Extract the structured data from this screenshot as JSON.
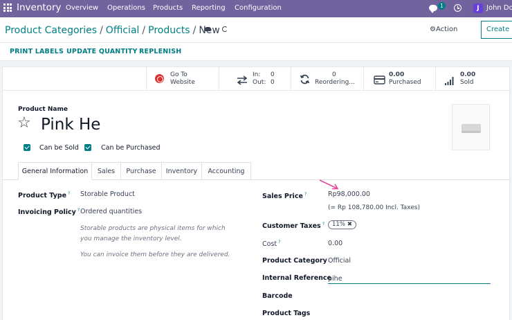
{
  "navbar": {
    "app_name": "Inventory",
    "menu": [
      "Overview",
      "Operations",
      "Products",
      "Reporting",
      "Configuration"
    ],
    "chat_badge": "1",
    "avatar_letter": "J",
    "user_name": "John Doe"
  },
  "control": {
    "breadcrumb": [
      "Product Categories",
      "Official",
      "Products",
      "New"
    ],
    "action_label": "Action",
    "create_label": "Create"
  },
  "actionbar": {
    "buttons": [
      "PRINT LABELS",
      "UPDATE QUANTITY",
      "REPLENISH"
    ]
  },
  "smart_buttons": {
    "website": {
      "line1": "Go To",
      "line2": "Website"
    },
    "in_out": {
      "in_label": "In:",
      "in_value": "0",
      "out_label": "Out:",
      "out_value": "0"
    },
    "reordering": {
      "value": "0",
      "label": "Reordering..."
    },
    "purchased": {
      "value": "0.00",
      "label": "Purchased"
    },
    "sold": {
      "value": "0.00",
      "label": "Sold"
    }
  },
  "form": {
    "name_label": "Product Name",
    "name_value": "Pink He",
    "can_be_sold": "Can be Sold",
    "can_be_purchased": "Can be Purchased",
    "tabs": [
      "General Information",
      "Sales",
      "Purchase",
      "Inventory",
      "Accounting"
    ],
    "left": {
      "product_type_label": "Product Type",
      "product_type_value": "Storable Product",
      "invoicing_policy_label": "Invoicing Policy",
      "invoicing_policy_value": "Ordered quantities",
      "help_storable": "Storable products are physical items for which you manage the inventory level.",
      "help_invoice": "You can invoice them before they are delivered."
    },
    "right": {
      "sales_price_label": "Sales Price",
      "sales_price_value": "Rp98,000.00",
      "sales_price_incl": "(= Rp 108,780.00 Incl. Taxes)",
      "customer_taxes_label": "Customer Taxes",
      "customer_taxes_tag": "11%",
      "cost_label": "Cost",
      "cost_value": "0.00",
      "product_category_label": "Product Category",
      "product_category_value": "Official",
      "internal_reference_label": "Internal Reference",
      "internal_reference_value": "pihe",
      "barcode_label": "Barcode",
      "product_tags_label": "Product Tags"
    }
  },
  "colors": {
    "navbar": "#71639e",
    "accent": "#017e84",
    "annotation_arrow": "#e8459b"
  }
}
